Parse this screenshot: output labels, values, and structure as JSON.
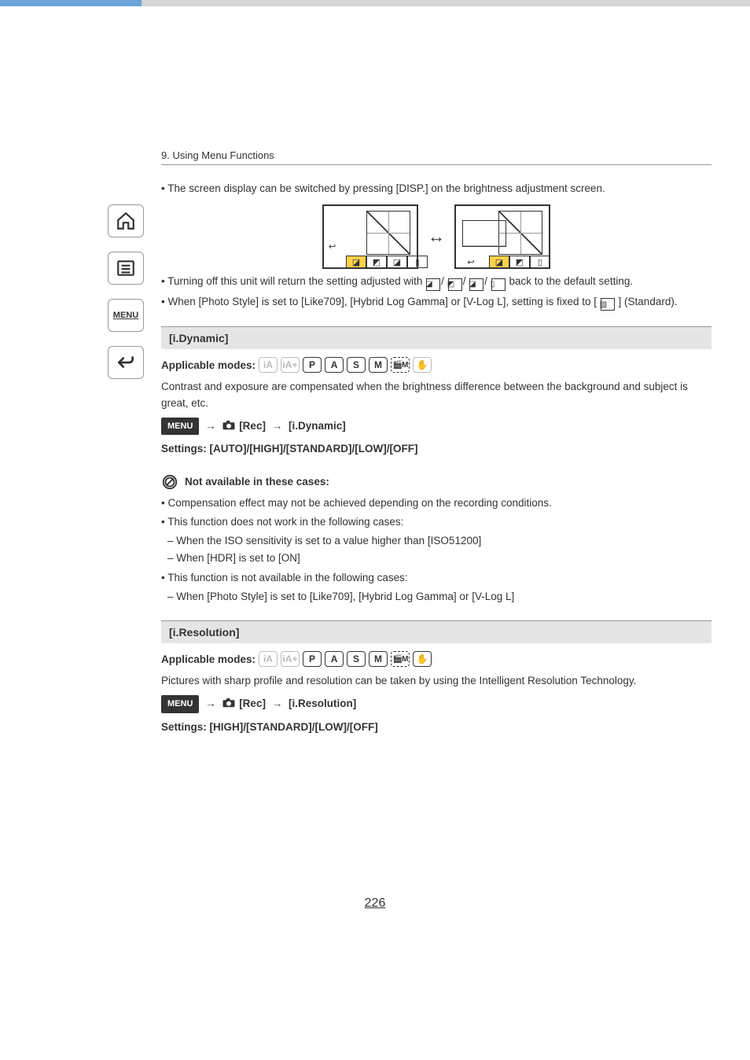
{
  "breadcrumb": "9. Using Menu Functions",
  "page_number": "226",
  "sidebar": {
    "home_name": "home-icon",
    "toc_name": "toc-icon",
    "menu_label": "MENU",
    "back_name": "back-icon"
  },
  "intro": {
    "line1": "The screen display can be switched by pressing [DISP.] on the brightness adjustment screen.",
    "line2_pre": "Turning off this unit will return the setting adjusted with ",
    "line2_post": " back to the default setting.",
    "line3_pre": "When [Photo Style] is set to [Like709], [Hybrid Log Gamma] or [V-Log L], setting is fixed to [",
    "line3_post": "] (Standard)."
  },
  "section1": {
    "title": "[i.Dynamic]",
    "modes_label": "Applicable modes:",
    "modes": [
      "iA",
      "iA+",
      "P",
      "A",
      "S",
      "M",
      "🎬M",
      "✋"
    ],
    "modes_enabled": [
      false,
      false,
      true,
      true,
      true,
      true,
      true,
      false
    ],
    "desc": "Contrast and exposure are compensated when the brightness difference between the background and subject is great, etc.",
    "menu_label": "MENU",
    "path1": "[Rec]",
    "path2": "[i.Dynamic]",
    "settings": "Settings: [AUTO]/[HIGH]/[STANDARD]/[LOW]/[OFF]"
  },
  "not_available": {
    "title": "Not available in these cases:",
    "b1": "Compensation effect may not be achieved depending on the recording conditions.",
    "b2": "This function does not work in the following cases:",
    "b2a": "When the ISO sensitivity is set to a value higher than [ISO51200]",
    "b2b": "When [HDR] is set to [ON]",
    "b3": "This function is not available in the following cases:",
    "b3a": "When [Photo Style] is set to [Like709], [Hybrid Log Gamma] or [V-Log L]"
  },
  "section2": {
    "title": "[i.Resolution]",
    "modes_label": "Applicable modes:",
    "modes": [
      "iA",
      "iA+",
      "P",
      "A",
      "S",
      "M",
      "🎬M",
      "✋"
    ],
    "modes_enabled": [
      false,
      false,
      true,
      true,
      true,
      true,
      true,
      true
    ],
    "desc": "Pictures with sharp profile and resolution can be taken by using the Intelligent Resolution Technology.",
    "menu_label": "MENU",
    "path1": "[Rec]",
    "path2": "[i.Resolution]",
    "settings": "Settings: [HIGH]/[STANDARD]/[LOW]/[OFF]"
  }
}
